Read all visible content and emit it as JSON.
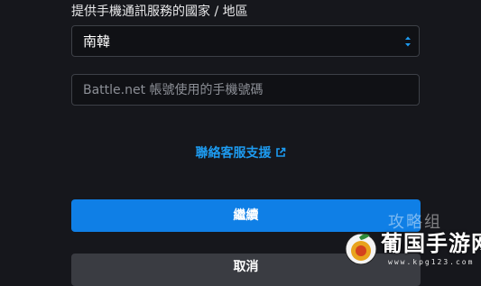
{
  "form": {
    "country_label": "提供手機通訊服務的國家 / 地區",
    "country_value": "南韓",
    "phone_placeholder": "Battle.net 帳號使用的手機號碼",
    "support_link": "聯絡客服支援",
    "continue_label": "繼續",
    "cancel_label": "取消"
  },
  "watermark": {
    "overlay_text": "攻略组",
    "title": "葡国手游网",
    "url": "www.kpg123.com"
  },
  "colors": {
    "background": "#16171c",
    "accent": "#0f7fe6",
    "link": "#1d9bf0",
    "secondary_button": "#3a3c42"
  },
  "icons": {
    "select_arrows": "up-down-arrows-icon",
    "external_link": "external-link-icon",
    "watermark_logo": "grape-logo-icon"
  }
}
